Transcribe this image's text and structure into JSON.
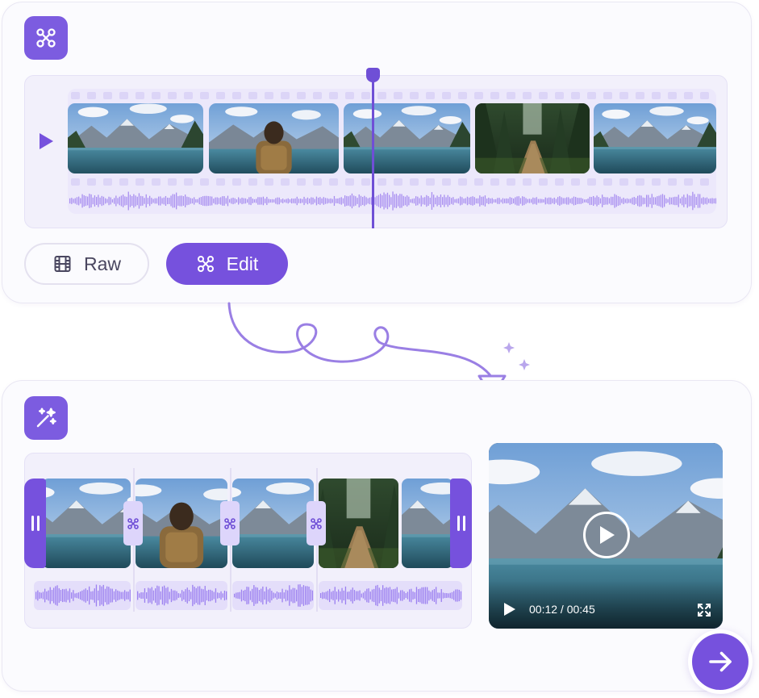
{
  "colors": {
    "accent": "#7651dd",
    "accent_light": "#ddd5fb",
    "panel_bg": "#f2f0fb",
    "card_bg": "#fbfbfe",
    "text_muted": "#4a4760"
  },
  "top_card": {
    "badge_icon": "scissors-icon",
    "timeline": {
      "frame_scenes": [
        "mountain-lake",
        "hiker-back-view",
        "lake-reflection",
        "forest-trail",
        "mountain-lake"
      ],
      "audio_waveform_icon": "waveform"
    },
    "mode_buttons": [
      {
        "label": "Raw",
        "icon": "film-icon",
        "active": false
      },
      {
        "label": "Edit",
        "icon": "scissors-icon",
        "active": true
      }
    ]
  },
  "connector": {
    "icon": "curly-arrow-down"
  },
  "bottom_card": {
    "badge_icon": "magic-wand-sparkles-icon",
    "clips": [
      "mountain-lake",
      "hiker-back-view",
      "lake-reflection",
      "forest-trail",
      "mountain-lake"
    ],
    "preview": {
      "scene": "mountain-lake",
      "current_time": "00:12",
      "separator": " / ",
      "duration": "00:45"
    },
    "next_icon": "arrow-right-icon"
  }
}
